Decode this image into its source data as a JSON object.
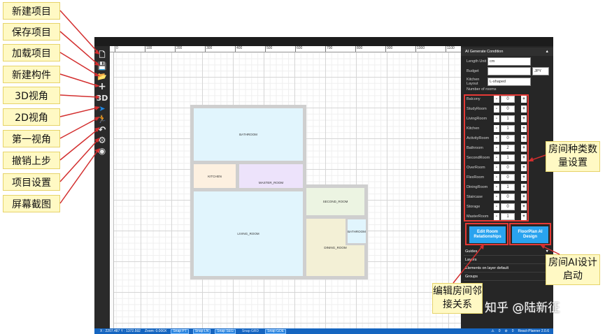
{
  "callouts": [
    "新建项目",
    "保存项目",
    "加载项目",
    "新建构件",
    "3D视角",
    "2D视角",
    "第一视角",
    "撤销上步",
    "项目设置",
    "屏幕截图"
  ],
  "toolbar": {
    "items": [
      {
        "icon": "new-file-icon",
        "glyph": "🗋"
      },
      {
        "icon": "save-icon",
        "glyph": "💾"
      },
      {
        "icon": "folder-open-icon",
        "glyph": "📂"
      },
      {
        "icon": "plus-icon",
        "glyph": "+"
      },
      {
        "icon": "3d-view-icon",
        "glyph": "3D"
      },
      {
        "icon": "pointer-icon",
        "glyph": "➤"
      },
      {
        "icon": "walk-icon",
        "glyph": "🏃"
      },
      {
        "icon": "undo-icon",
        "glyph": "↶"
      },
      {
        "icon": "gear-icon",
        "glyph": "⚙"
      },
      {
        "icon": "camera-icon",
        "glyph": "◉"
      }
    ]
  },
  "ruler": {
    "ticks": [
      "0",
      "100",
      "200",
      "300",
      "400",
      "500",
      "600",
      "700",
      "800",
      "900",
      "1000",
      "1100"
    ]
  },
  "rooms": {
    "bathroom_top": "BATHROOM",
    "kitchen": "KITCHEN",
    "master_room": "MASTER_ROOM",
    "living_room": "LIVING_ROOM",
    "second_room": "SECOND_ROOM",
    "bathroom_small": "BATHROOM",
    "dining_room": "DINING_ROOM"
  },
  "status": {
    "coords": "X : 2207.487 Y : 1372.592",
    "zoom": "Zoom: 0.000X",
    "snaps": [
      "Snap PT",
      "Snap LN",
      "Snap SEG",
      "Snap GRD",
      "Snap GDE"
    ],
    "version": "React-Planner 2.0.6",
    "warnings": "0",
    "errors": "0"
  },
  "panel": {
    "title": "AI Generate Condition",
    "length_unit_label": "Length Unit",
    "length_unit_value": "cm",
    "budget_label": "Budget",
    "budget_value": "",
    "budget_currency": "JPY",
    "kitchen_layout_label": "Kitchen Layout",
    "kitchen_layout_value": "L-shaped",
    "num_rooms_label": "Number of rooms",
    "room_counts": [
      {
        "name": "Balcony",
        "value": "0"
      },
      {
        "name": "StudyRoom",
        "value": "0"
      },
      {
        "name": "LivingRoom",
        "value": "1"
      },
      {
        "name": "Kitchen",
        "value": "1"
      },
      {
        "name": "ActivityRoom",
        "value": "0"
      },
      {
        "name": "Bathroom",
        "value": "2"
      },
      {
        "name": "SecondRoom",
        "value": "1"
      },
      {
        "name": "OverRoom",
        "value": "0"
      },
      {
        "name": "FlexRoom",
        "value": "0"
      },
      {
        "name": "DiningRoom",
        "value": "1"
      },
      {
        "name": "Staircase",
        "value": "0"
      },
      {
        "name": "Storage",
        "value": "0"
      },
      {
        "name": "MasterRoom",
        "value": "1"
      }
    ],
    "minus": "-",
    "plus": "+",
    "edit_btn": "Edit Room Relationships",
    "ai_btn": "FloorPlan AI Design",
    "sections": [
      "Guides",
      "Layers",
      "Elements on layer default",
      "Groups"
    ]
  },
  "annotations": {
    "room_settings": "房间种类数量设置",
    "ai_design": "房间AI设计启动",
    "edit_relations": "编辑房间邻接关系"
  },
  "watermark": "知乎 @陆新征",
  "colors": {
    "accent": "#29a3ef",
    "callout_bg": "#fff9c4",
    "highlight": "#e53935"
  }
}
